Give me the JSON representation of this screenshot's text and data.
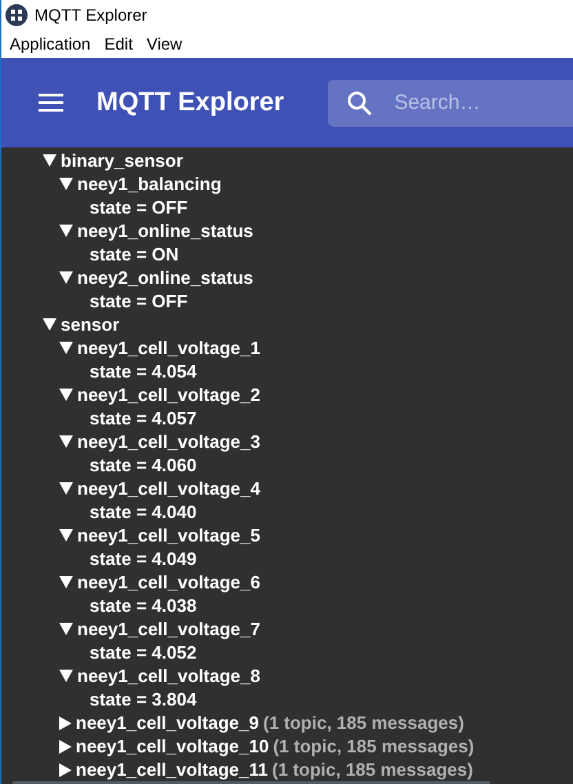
{
  "window": {
    "title": "MQTT Explorer"
  },
  "menu": [
    "Application",
    "Edit",
    "View"
  ],
  "app_bar": {
    "title": "MQTT Explorer",
    "search": {
      "placeholder": "Search…"
    }
  },
  "tree": [
    {
      "kind": "topic",
      "name": "binary_sensor",
      "expanded": true,
      "children": [
        {
          "kind": "topic",
          "name": "neey1_balancing",
          "expanded": true,
          "children": [
            {
              "kind": "value",
              "text": "state = OFF"
            }
          ]
        },
        {
          "kind": "topic",
          "name": "neey1_online_status",
          "expanded": true,
          "children": [
            {
              "kind": "value",
              "text": "state = ON"
            }
          ]
        },
        {
          "kind": "topic",
          "name": "neey2_online_status",
          "expanded": true,
          "children": [
            {
              "kind": "value",
              "text": "state = OFF"
            }
          ]
        }
      ]
    },
    {
      "kind": "topic",
      "name": "sensor",
      "expanded": true,
      "children": [
        {
          "kind": "topic",
          "name": "neey1_cell_voltage_1",
          "expanded": true,
          "children": [
            {
              "kind": "value",
              "text": "state = 4.054"
            }
          ]
        },
        {
          "kind": "topic",
          "name": "neey1_cell_voltage_2",
          "expanded": true,
          "children": [
            {
              "kind": "value",
              "text": "state = 4.057"
            }
          ]
        },
        {
          "kind": "topic",
          "name": "neey1_cell_voltage_3",
          "expanded": true,
          "children": [
            {
              "kind": "value",
              "text": "state = 4.060"
            }
          ]
        },
        {
          "kind": "topic",
          "name": "neey1_cell_voltage_4",
          "expanded": true,
          "children": [
            {
              "kind": "value",
              "text": "state = 4.040"
            }
          ]
        },
        {
          "kind": "topic",
          "name": "neey1_cell_voltage_5",
          "expanded": true,
          "children": [
            {
              "kind": "value",
              "text": "state = 4.049"
            }
          ]
        },
        {
          "kind": "topic",
          "name": "neey1_cell_voltage_6",
          "expanded": true,
          "children": [
            {
              "kind": "value",
              "text": "state = 4.038"
            }
          ]
        },
        {
          "kind": "topic",
          "name": "neey1_cell_voltage_7",
          "expanded": true,
          "children": [
            {
              "kind": "value",
              "text": "state = 4.052"
            }
          ]
        },
        {
          "kind": "topic",
          "name": "neey1_cell_voltage_8",
          "expanded": true,
          "children": [
            {
              "kind": "value",
              "text": "state = 3.804"
            }
          ]
        },
        {
          "kind": "topic",
          "name": "neey1_cell_voltage_9",
          "expanded": false,
          "summary": "(1 topic, 185 messages)"
        },
        {
          "kind": "topic",
          "name": "neey1_cell_voltage_10",
          "expanded": false,
          "summary": "(1 topic, 185 messages)"
        },
        {
          "kind": "topic",
          "name": "neey1_cell_voltage_11",
          "expanded": false,
          "summary": "(1 topic, 185 messages)"
        }
      ]
    }
  ]
}
